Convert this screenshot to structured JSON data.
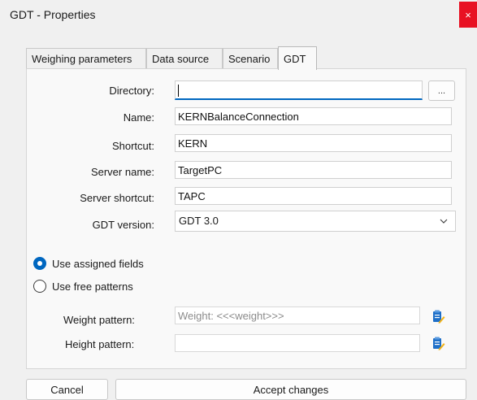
{
  "window": {
    "title": "GDT - Properties",
    "close_label": "×",
    "close_color": "#e81123",
    "accent_color": "#0067c0"
  },
  "tabs": [
    {
      "label": "Weighing parameters",
      "active": false
    },
    {
      "label": "Data source",
      "active": false
    },
    {
      "label": "Scenario",
      "active": false
    },
    {
      "label": "GDT",
      "active": true
    }
  ],
  "form": {
    "directory": {
      "label": "Directory:",
      "value": "",
      "browse_label": "..."
    },
    "name": {
      "label": "Name:",
      "value": "KERNBalanceConnection"
    },
    "shortcut": {
      "label": "Shortcut:",
      "value": "KERN"
    },
    "server_name": {
      "label": "Server name:",
      "value": "TargetPC"
    },
    "server_shortcut": {
      "label": "Server shortcut:",
      "value": "TAPC"
    },
    "gdt_version": {
      "label": "GDT version:",
      "value": "GDT 3.0"
    }
  },
  "options": {
    "use_assigned_fields": {
      "label": "Use assigned fields",
      "checked": true
    },
    "use_free_patterns": {
      "label": "Use free patterns",
      "checked": false
    }
  },
  "patterns": {
    "weight": {
      "label": "Weight pattern:",
      "value": "Weight: <<<weight>>>",
      "icon": "clipboard-edit-icon"
    },
    "height": {
      "label": "Height pattern:",
      "value": "",
      "icon": "clipboard-edit-icon"
    }
  },
  "buttons": {
    "cancel": "Cancel",
    "accept": "Accept changes"
  }
}
